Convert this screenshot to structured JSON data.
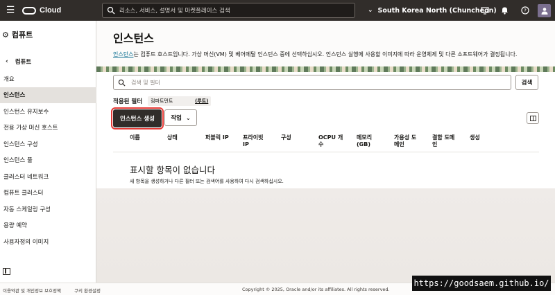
{
  "topbar": {
    "logo_text": "Cloud",
    "search_placeholder": "리소스, 서비스, 설명서 및 마켓플레이스 검색",
    "region": "South Korea North (Chuncheon)",
    "icons": [
      "menu-icon",
      "search-icon",
      "chevron-down-icon",
      "cloud-shell-icon",
      "bell-icon",
      "help-icon",
      "user-avatar"
    ]
  },
  "sidebar": {
    "title": "컴퓨트",
    "back_label": "컴퓨트",
    "items": [
      {
        "label": "개요",
        "active": false
      },
      {
        "label": "인스턴스",
        "active": true
      },
      {
        "label": "인스턴스 유지보수",
        "active": false
      },
      {
        "label": "전용 가상 머신 호스트",
        "active": false
      },
      {
        "label": "인스턴스 구성",
        "active": false
      },
      {
        "label": "인스턴스 풀",
        "active": false
      },
      {
        "label": "클러스터 네트워크",
        "active": false
      },
      {
        "label": "컴퓨트 클러스터",
        "active": false
      },
      {
        "label": "자동 스케일링 구성",
        "active": false
      },
      {
        "label": "용량 예약",
        "active": false
      },
      {
        "label": "사용자정의 이미지",
        "active": false
      }
    ]
  },
  "page": {
    "title": "인스턴스",
    "desc_link": "인스턴스",
    "desc_rest": "는 컴퓨트 호스트입니다. 가상 머신(VM) 및 베어메탈 인스턴스 중에 선택하십시오. 인스턴스 실행에 사용할 이미지에 따라 운영체제 및 다른 소프트웨어가 결정됩니다."
  },
  "toolbar": {
    "filter_placeholder": "검색 및 필터",
    "search_button": "검색",
    "applied_filters_label": "적용된 필터",
    "chip_label": "컴파트먼트",
    "chip_value": "(루트)",
    "create_button": "인스턴스 생성",
    "action_button": "작업"
  },
  "table": {
    "columns": [
      [
        "이름"
      ],
      [
        "상태"
      ],
      [
        "퍼블릭 IP"
      ],
      [
        "프라이빗",
        "IP"
      ],
      [
        "구성"
      ],
      [
        "OCPU 개",
        "수"
      ],
      [
        "메모리",
        "(GB)"
      ],
      [
        "가용성 도",
        "메인"
      ],
      [
        "결함 도메",
        "인"
      ],
      [
        "생성"
      ]
    ],
    "empty_title": "표시할 항목이 없습니다",
    "empty_desc": "새 항목을 생성하거나 다른 필터 또는 검색어를 사용하여 다시 검색하십시오."
  },
  "footer": {
    "terms": "이용약관 및 개인정보 보호정책",
    "cookies": "쿠키 환경설정",
    "copyright": "Copyright © 2025, Oracle and/or its affiliates. All rights reserved."
  },
  "watermark": "https://goodsaem.github.io/"
}
